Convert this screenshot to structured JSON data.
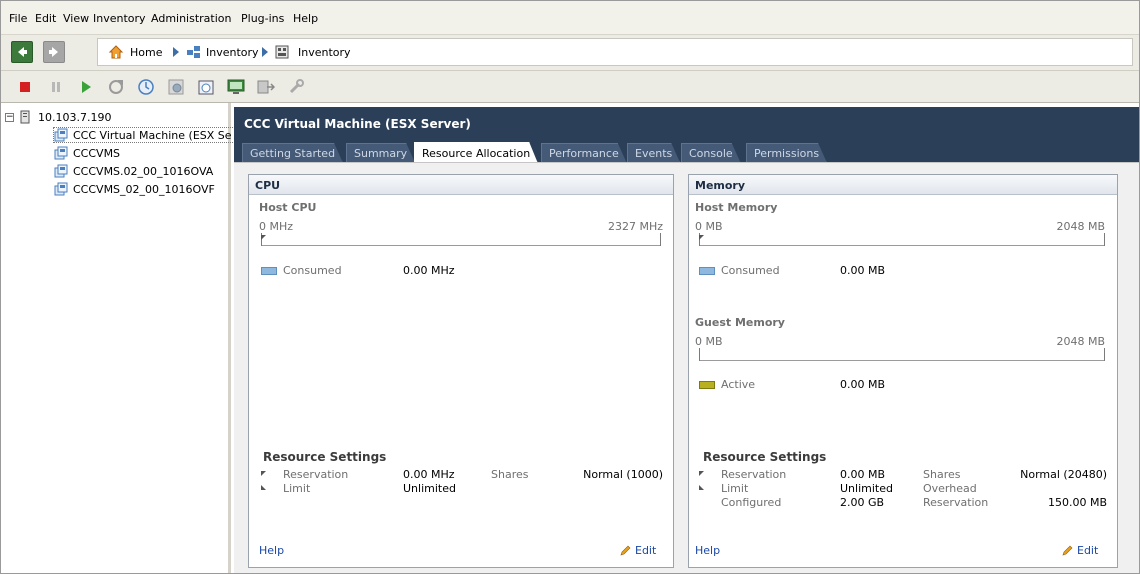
{
  "menu": [
    "File",
    "Edit",
    "View",
    "Inventory",
    "Administration",
    "Plug-ins",
    "Help"
  ],
  "breadcrumb": {
    "home": "Home",
    "inventory1": "Inventory",
    "inventory2": "Inventory"
  },
  "toolbar_icons": [
    "power-off-icon",
    "suspend-icon",
    "power-on-icon",
    "reset-icon",
    "snapshot-icon",
    "revert-snapshot-icon",
    "manage-snapshots-icon",
    "console-icon",
    "migrate-icon",
    "tools-icon"
  ],
  "tree": {
    "host": "10.103.7.190",
    "vms": [
      "CCC Virtual Machine (ESX Se",
      "CCCVMS",
      "CCCVMS.02_00_1016OVA",
      "CCCVMS_02_00_1016OVF"
    ]
  },
  "vm_title": "CCC Virtual Machine (ESX Server)",
  "tabs": [
    "Getting Started",
    "Summary",
    "Resource Allocation",
    "Performance",
    "Events",
    "Console",
    "Permissions"
  ],
  "active_tab": "Resource Allocation",
  "cpu": {
    "header": "CPU",
    "host_label": "Host CPU",
    "min": "0 MHz",
    "max": "2327 MHz",
    "consumed_label": "Consumed",
    "consumed_value": "0.00 MHz",
    "consumed_color": "#8fb8de",
    "settings_label": "Resource Settings",
    "reservation_label": "Reservation",
    "reservation_value": "0.00 MHz",
    "limit_label": "Limit",
    "limit_value": "Unlimited",
    "shares_label": "Shares",
    "shares_value": "Normal (1000)",
    "help": "Help",
    "edit": "Edit"
  },
  "memory": {
    "header": "Memory",
    "host_label": "Host Memory",
    "host_min": "0 MB",
    "host_max": "2048 MB",
    "consumed_label": "Consumed",
    "consumed_value": "0.00 MB",
    "consumed_color": "#8fb8de",
    "guest_label": "Guest Memory",
    "guest_min": "0 MB",
    "guest_max": "2048 MB",
    "active_label": "Active",
    "active_value": "0.00 MB",
    "active_color": "#b8b020",
    "settings_label": "Resource Settings",
    "reservation_label": "Reservation",
    "reservation_value": "0.00 MB",
    "limit_label": "Limit",
    "limit_value": "Unlimited",
    "configured_label": "Configured",
    "configured_value": "2.00 GB",
    "shares_label": "Shares",
    "shares_value": "Normal (20480)",
    "overhead_label": "Overhead",
    "overhead_reservation_label": "Reservation",
    "overhead_reservation_value": "150.00 MB",
    "help": "Help",
    "edit": "Edit"
  },
  "colors": {
    "title_bar": "#2b3f58",
    "link": "#1a47a8",
    "power_off": "#d42020",
    "power_on": "#3aa23a"
  }
}
